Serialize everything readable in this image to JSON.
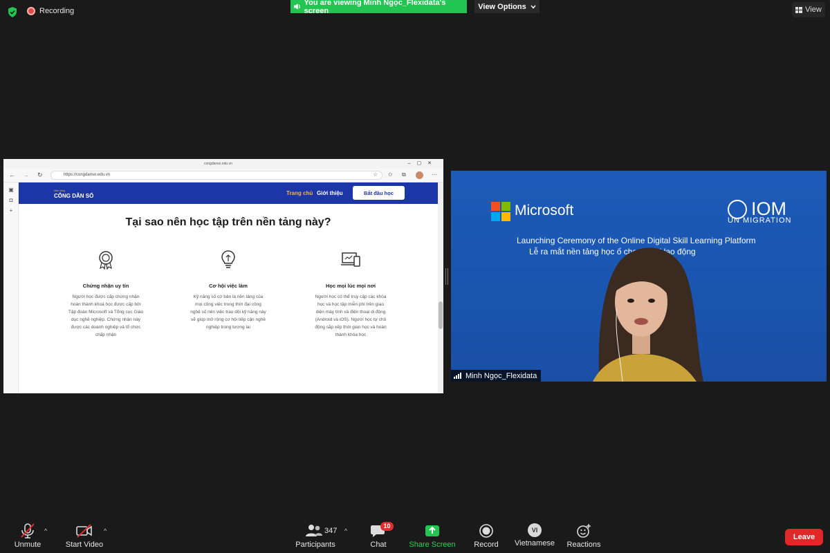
{
  "topbar": {
    "recording_label": "Recording",
    "viewing_banner": "You are viewing Minh Ngọc_Flexidata's screen",
    "view_options_label": "View Options",
    "view_label": "View"
  },
  "browser": {
    "tab_title": "congdanso.edu.vn",
    "url": "https://congdanso.edu.vn",
    "site": {
      "logo_small": "Nền tảng",
      "logo_main": "CÔNG DÂN SỐ",
      "nav_home": "Trang chủ",
      "nav_about": "Giới thiệu",
      "start_button": "Bắt đầu học",
      "heading": "Tại sao nên học tập trên nền tảng này?",
      "features": [
        {
          "icon": "certificate-icon",
          "title": "Chứng nhận uy tín",
          "lines": [
            "Người học được cấp chứng nhận",
            "hoàn thành khoá học được cấp bởi",
            "Tập đoàn Microsoft và Tổng cục Giáo",
            "dục nghề nghiệp. Chứng nhận này",
            "được các doanh nghiệp và tổ chức",
            "chấp nhận"
          ]
        },
        {
          "icon": "lightbulb-icon",
          "title": "Cơ hội việc làm",
          "lines": [
            "Kỹ năng số cơ bản là nền tảng của",
            "mọi công việc trong thời đại công",
            "nghệ số nên việc trau dồi kỹ năng này",
            "sẽ giúp mở rộng cơ hội tiếp cận nghề",
            "nghiệp trong tương lai"
          ]
        },
        {
          "icon": "devices-icon",
          "title": "Học mọi lúc mọi nơi",
          "lines": [
            "Người học có thể truy cập các khóa",
            "học và học tập miễn phí trên giao",
            "diện máy tính và điện thoại di động",
            "(Android và iOS). Người học tự chủ",
            "động sắp xếp thời gian học và hoàn",
            "thành khóa học"
          ]
        }
      ]
    }
  },
  "video": {
    "microsoft_text": "Microsoft",
    "iom_text": "IOM",
    "iom_sub": "UN MIGRATION",
    "ceremony_line_1": "Launching Ceremony of the Online Digital Skill Learning Platform",
    "ceremony_line_2": "Lễ ra mắt nền tảng học              ố cho người lao động",
    "participant_name": "Minh Ngọc_Flexidata"
  },
  "toolbar": {
    "unmute": "Unmute",
    "start_video": "Start Video",
    "participants": "Participants",
    "participant_count": "347",
    "chat": "Chat",
    "chat_badge": "10",
    "share_screen": "Share Screen",
    "record": "Record",
    "language": "Vietnamese",
    "language_code": "VI",
    "reactions": "Reactions",
    "leave": "Leave"
  },
  "colors": {
    "banner_green": "#23c552",
    "site_header_blue": "#1d36a7",
    "accent_yellow": "#f4b63f",
    "leave_red": "#e02828"
  }
}
